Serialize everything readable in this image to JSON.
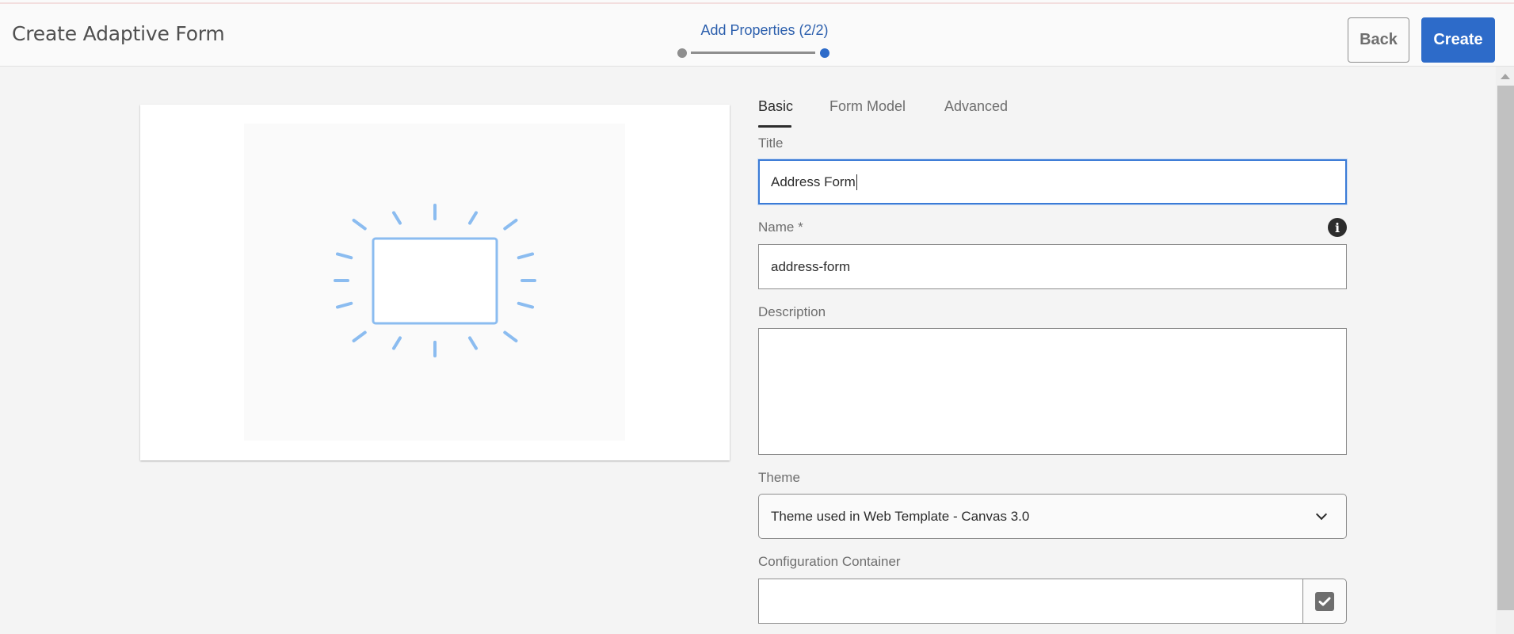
{
  "header": {
    "title": "Create Adaptive Form",
    "stepper": {
      "label": "Add Properties (2/2)",
      "current_step": 2,
      "total_steps": 2
    },
    "back_label": "Back",
    "create_label": "Create"
  },
  "colors": {
    "accent": "#2d6bc9",
    "step_label": "#2c5fad",
    "illustration": "#8bbcf0"
  },
  "preview": {
    "icon": "form-placeholder-illustration"
  },
  "tabs": [
    {
      "label": "Basic",
      "active": true
    },
    {
      "label": "Form Model",
      "active": false
    },
    {
      "label": "Advanced",
      "active": false
    }
  ],
  "form": {
    "title": {
      "label": "Title",
      "value": "Address Form"
    },
    "name": {
      "label": "Name *",
      "value": "address-form",
      "info_icon": "info-icon"
    },
    "description": {
      "label": "Description",
      "value": ""
    },
    "theme": {
      "label": "Theme",
      "selected": "Theme used in Web Template - Canvas 3.0"
    },
    "configuration_container": {
      "label": "Configuration Container",
      "value": "",
      "button_icon": "checkbox-check-icon"
    }
  }
}
